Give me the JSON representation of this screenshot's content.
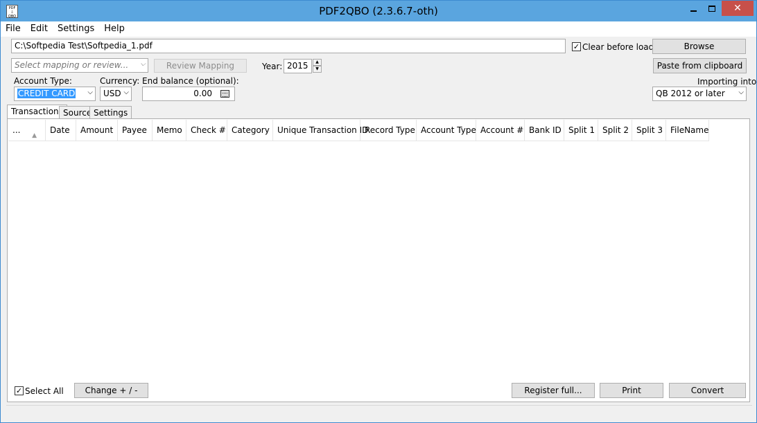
{
  "window": {
    "title": "PDF2QBO (2.3.6.7-oth)",
    "icon_text": "PDF\n⇩\nQBO",
    "min_icon": "minimize-icon",
    "max_icon": "maximize-icon",
    "close_glyph": "✕"
  },
  "menu": [
    "File",
    "Edit",
    "Settings",
    "Help"
  ],
  "file_path": "C:\\Softpedia Test\\Softpedia_1.pdf",
  "clear_before_load": {
    "label": "Clear before load",
    "checked": "✓"
  },
  "buttons": {
    "browse": "Browse",
    "paste": "Paste from clipboard",
    "review_mapping": "Review Mapping",
    "change": "Change + / -",
    "register": "Register full...",
    "print": "Print",
    "convert": "Convert"
  },
  "mapping": {
    "placeholder": "Select mapping or review..."
  },
  "year": {
    "label": "Year:",
    "value": "2015"
  },
  "account_type": {
    "label": "Account Type:",
    "value": "CREDIT CARD"
  },
  "currency": {
    "label": "Currency:",
    "value": "USD"
  },
  "end_balance": {
    "label": "End balance (optional):",
    "value": "0.00"
  },
  "importing": {
    "label": "Importing into:",
    "value": "QB 2012 or later"
  },
  "tabs": [
    "Transactions",
    "Source",
    "Settings"
  ],
  "columns": [
    "...",
    "Date",
    "Amount",
    "Payee",
    "Memo",
    "Check #",
    "Category",
    "Unique Transaction ID",
    "Record Type",
    "Account Type",
    "Account #",
    "Bank ID",
    "Split 1",
    "Split 2",
    "Split 3",
    "FileName"
  ],
  "select_all": {
    "label": "Select All",
    "checked": "✓"
  },
  "glyphs": {
    "dropdown": "⌵",
    "sort": "▲",
    "spin_up": "▲",
    "spin_down": "▼"
  }
}
